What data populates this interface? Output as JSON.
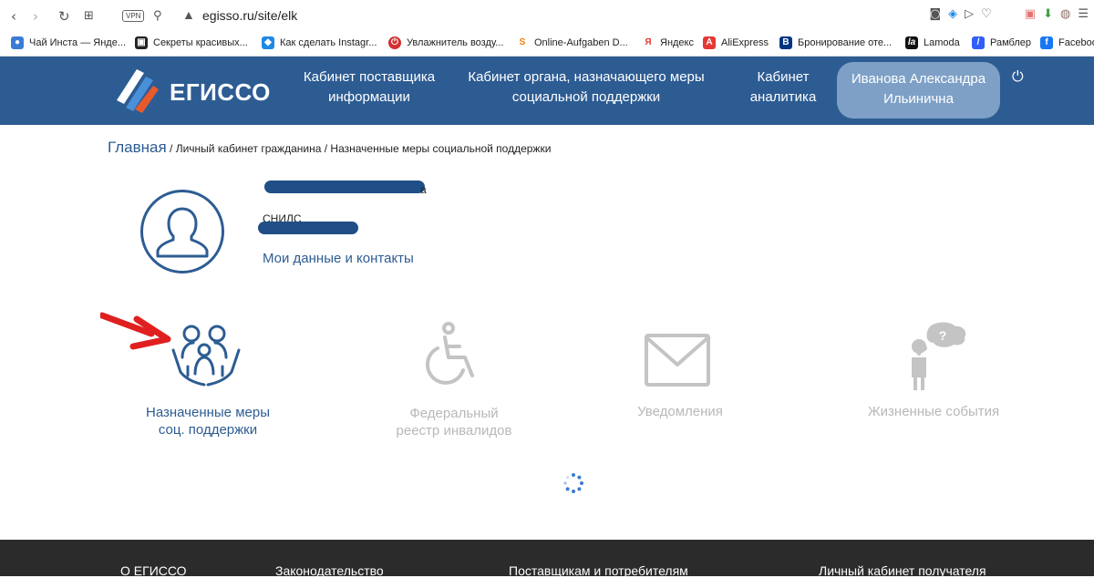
{
  "browser": {
    "url": "egisso.ru/site/elk",
    "vpn_label": "VPN",
    "bookmarks": [
      {
        "label": "Чай Инста — Янде...",
        "color": "#3a7bd5",
        "glyph": "●"
      },
      {
        "label": "Секреты красивых...",
        "color": "#222222",
        "glyph": "▣"
      },
      {
        "label": "Как сделать Instagr...",
        "color": "#1e88e5",
        "glyph": "◆"
      },
      {
        "label": "Увлажнитель возду...",
        "color": "#d32f2f",
        "glyph": "⏻"
      },
      {
        "label": "Online-Aufgaben D...",
        "color": "#f57c00",
        "glyph": "S"
      },
      {
        "label": "Яндекс",
        "color": "#e53935",
        "glyph": "Я"
      },
      {
        "label": "AliExpress",
        "color": "#e53935",
        "glyph": "A"
      },
      {
        "label": "Бронирование оте...",
        "color": "#003580",
        "glyph": "B"
      },
      {
        "label": "Lamoda",
        "color": "#111111",
        "glyph": "la"
      },
      {
        "label": "Рамблер",
        "color": "#315efb",
        "glyph": "/"
      },
      {
        "label": "Faceboo",
        "color": "#1877f2",
        "glyph": "f"
      }
    ]
  },
  "header": {
    "logo_text": "ЕГИССО",
    "nav": [
      {
        "line1": "Кабинет поставщика",
        "line2": "информации"
      },
      {
        "line1": "Кабинет органа, назначающего меры",
        "line2": "социальной поддержки"
      },
      {
        "line1": "Кабинет",
        "line2": "аналитика"
      }
    ],
    "user": {
      "line1": "Иванова Александра",
      "line2": "Ильинична"
    },
    "brand_color": "#2d5c93"
  },
  "breadcrumb": {
    "home": "Главная",
    "rest": " / Личный кабинет гражданина / Назначенные меры социальной поддержки"
  },
  "profile": {
    "name_tail": "а",
    "snils_label": "СНИЛС",
    "contacts_link": "Мои данные и контакты"
  },
  "tiles": [
    {
      "line1": "Назначенные меры",
      "line2": "соц. поддержки",
      "active": true
    },
    {
      "line1": "Федеральный",
      "line2": "реестр инвалидов",
      "active": false
    },
    {
      "line1": "Уведомления",
      "line2": "",
      "active": false
    },
    {
      "line1": "Жизненные события",
      "line2": "",
      "active": false
    }
  ],
  "footer": {
    "links": [
      "О ЕГИССО",
      "Законодательство",
      "Поставщикам и потребителям",
      "Личный кабинет получателя"
    ]
  }
}
